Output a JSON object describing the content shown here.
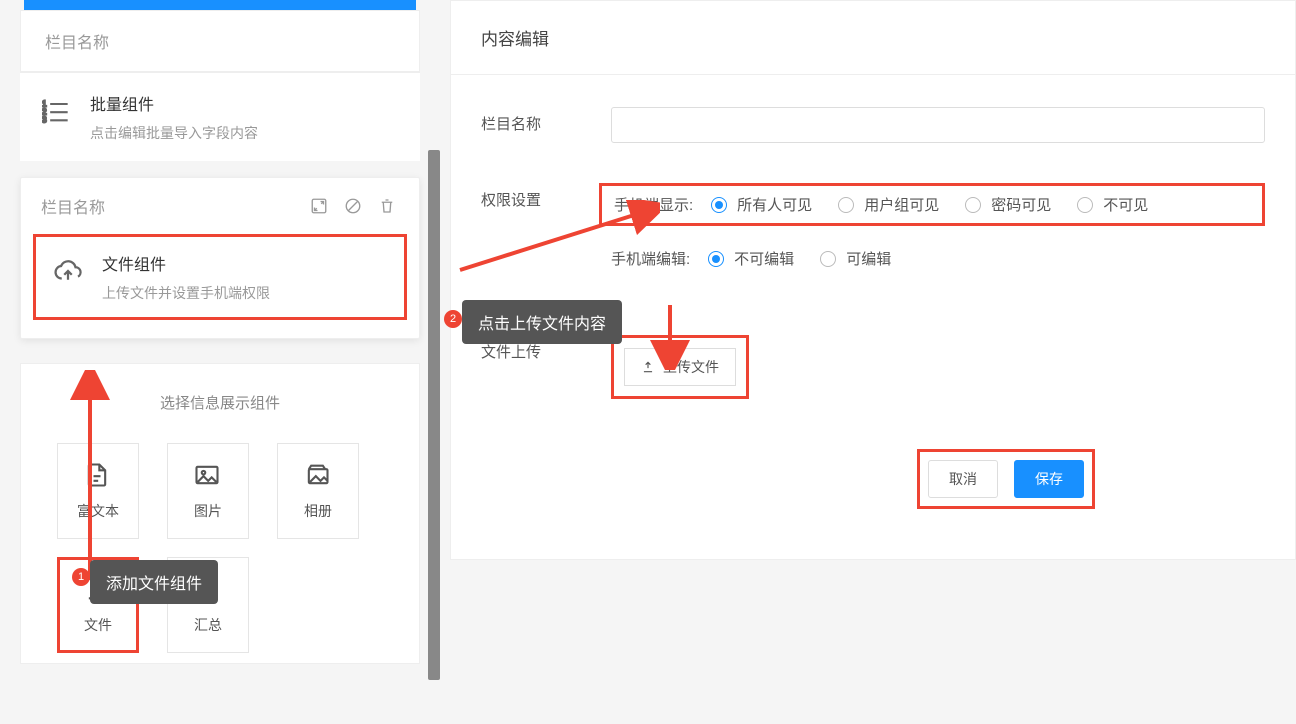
{
  "left": {
    "section1_name": "栏目名称",
    "batch": {
      "title": "批量组件",
      "desc": "点击编辑批量导入字段内容"
    },
    "section2_name": "栏目名称",
    "file": {
      "title": "文件组件",
      "desc": "上传文件并设置手机端权限"
    },
    "picker": {
      "title": "选择信息展示组件",
      "items": [
        "富文本",
        "图片",
        "相册",
        "文件",
        "汇总"
      ]
    }
  },
  "right": {
    "title": "内容编辑",
    "labels": {
      "name": "栏目名称",
      "perm": "权限设置",
      "upload": "文件上传"
    },
    "display": {
      "label": "手机端显示:",
      "options": [
        "所有人可见",
        "用户组可见",
        "密码可见",
        "不可见"
      ]
    },
    "edit": {
      "label": "手机端编辑:",
      "options": [
        "不可编辑",
        "可编辑"
      ]
    },
    "upload_btn": "上传文件",
    "cancel": "取消",
    "save": "保存"
  },
  "tooltips": {
    "t1": "添加文件组件",
    "t2": "点击上传文件内容",
    "b1": "1",
    "b2": "2"
  }
}
